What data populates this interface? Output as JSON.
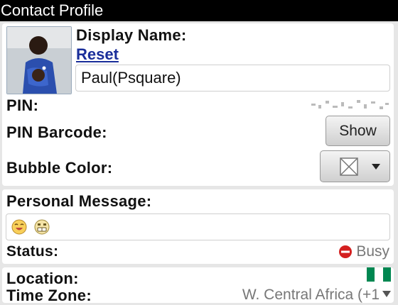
{
  "title": "Contact Profile",
  "profile": {
    "display_name_label": "Display Name:",
    "reset_link": "Reset",
    "display_name_value": "Paul(Psquare)",
    "pin_label": "PIN:",
    "pin_barcode_label": "PIN Barcode:",
    "show_button": "Show",
    "bubble_color_label": "Bubble Color:"
  },
  "personal": {
    "personal_message_label": "Personal Message:",
    "emoticons": [
      "laughing-emoticon-icon",
      "grinning-emoticon-icon"
    ],
    "status_label": "Status:",
    "status_value": "Busy",
    "status_color": "#d42020"
  },
  "location": {
    "location_label": "Location:",
    "flag_colors": [
      "#008751",
      "#ffffff",
      "#008751"
    ],
    "time_zone_label": "Time Zone:",
    "time_zone_value": "W. Central Africa (+1"
  }
}
